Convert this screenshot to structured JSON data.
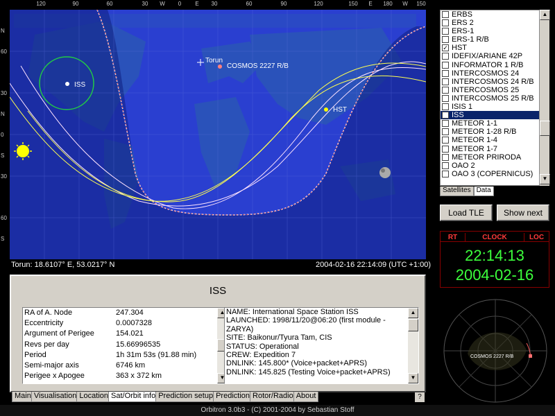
{
  "map": {
    "lon_labels": [
      "120",
      "90",
      "60",
      "30",
      "W",
      "0",
      "E",
      "30",
      "60",
      "90",
      "120",
      "150",
      "E",
      "180",
      "W",
      "150"
    ],
    "lat_labels": [
      "N",
      "60",
      "30",
      "N",
      "0",
      "S",
      "30",
      "60",
      "S"
    ],
    "observer_label": "Torun",
    "observer_coords": "Torun: 18.6107° E, 53.0217° N",
    "datetime": "2004-02-16 22:14:09 (UTC +1:00)",
    "satellite_labels": {
      "cosmos": "COSMOS 2227 R/B",
      "iss": "ISS",
      "hst": "HST"
    }
  },
  "satellites": [
    {
      "name": "ERBS",
      "checked": false,
      "selected": false
    },
    {
      "name": "ERS 2",
      "checked": false,
      "selected": false
    },
    {
      "name": "ERS-1",
      "checked": false,
      "selected": false
    },
    {
      "name": "ERS-1 R/B",
      "checked": false,
      "selected": false
    },
    {
      "name": "HST",
      "checked": true,
      "selected": false
    },
    {
      "name": "IDEFIX/ARIANE 42P",
      "checked": false,
      "selected": false
    },
    {
      "name": "INFORMATOR 1 R/B",
      "checked": false,
      "selected": false
    },
    {
      "name": "INTERCOSMOS 24",
      "checked": false,
      "selected": false
    },
    {
      "name": "INTERCOSMOS 24 R/B",
      "checked": false,
      "selected": false
    },
    {
      "name": "INTERCOSMOS 25",
      "checked": false,
      "selected": false
    },
    {
      "name": "INTERCOSMOS 25 R/B",
      "checked": false,
      "selected": false
    },
    {
      "name": "ISIS 1",
      "checked": false,
      "selected": false
    },
    {
      "name": "ISS",
      "checked": true,
      "selected": true
    },
    {
      "name": "METEOR 1-1",
      "checked": false,
      "selected": false
    },
    {
      "name": "METEOR 1-28 R/B",
      "checked": false,
      "selected": false
    },
    {
      "name": "METEOR 1-4",
      "checked": false,
      "selected": false
    },
    {
      "name": "METEOR 1-7",
      "checked": false,
      "selected": false
    },
    {
      "name": "METEOR PRIRODA",
      "checked": false,
      "selected": false
    },
    {
      "name": "OAO 2",
      "checked": false,
      "selected": false
    },
    {
      "name": "OAO 3 (COPERNICUS)",
      "checked": false,
      "selected": false
    }
  ],
  "list_tabs": {
    "satellites": "Satellites",
    "data": "Data"
  },
  "buttons": {
    "load_tle": "Load TLE",
    "show_next": "Show next"
  },
  "clock": {
    "rt": "RT",
    "clock": "CLOCK",
    "loc": "LOC",
    "time": "22:14:13",
    "date": "2004-02-16"
  },
  "radar": {
    "label": "COSMOS 2227 R/B"
  },
  "info": {
    "title": "ISS",
    "params": [
      {
        "k": "RA of A. Node",
        "v": "247.304"
      },
      {
        "k": "Eccentricity",
        "v": "0.0007328"
      },
      {
        "k": "Argument of Perigee",
        "v": "154.021"
      },
      {
        "k": "Revs per day",
        "v": "15.66996535"
      },
      {
        "k": "Period",
        "v": "1h 31m 53s (91.88 min)"
      },
      {
        "k": "Semi-major axis",
        "v": "6746 km"
      },
      {
        "k": "Perigee x Apogee",
        "v": "363 x 372 km"
      }
    ],
    "description": [
      "NAME: International Space Station ISS",
      "LAUNCHED: 1998/11/20@06:20 (first module -",
      "ZARYA)",
      "SITE: Baikonur/Tyura Tam, CIS",
      "STATUS: Operational",
      "CREW: Expedition 7",
      "DNLINK: 145.800* (Voice+packet+APRS)",
      "DNLINK: 145.825 (Testing Voice+packet+APRS)"
    ]
  },
  "bottom_tabs": [
    "Main",
    "Visualisation",
    "Location",
    "Sat/Orbit info",
    "Prediction setup",
    "Prediction",
    "Rotor/Radio",
    "About"
  ],
  "active_bottom_tab": "Sat/Orbit info",
  "help": "?",
  "status": "Orbitron 3.0b3 - (C) 2001-2004 by Sebastian Stoff",
  "colors": {
    "ocean": "#1a2fb8",
    "night": "#0e1f80",
    "clock_green": "#3cff3c",
    "clock_red": "#ff3a3a",
    "select": "#0a246a"
  }
}
